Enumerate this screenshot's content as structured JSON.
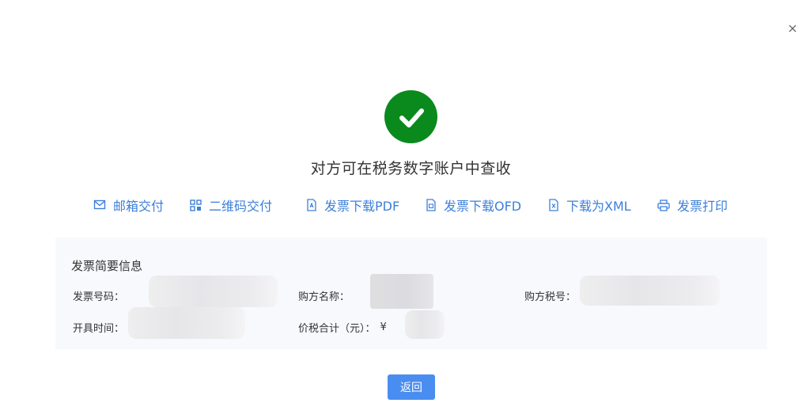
{
  "dialog": {
    "close_icon": "close-icon",
    "status_icon": "check-circle-icon",
    "status_color": "#0a8a1c",
    "message": "对方可在税务数字账户中查收"
  },
  "actions": [
    {
      "label": "邮箱交付",
      "icon": "mail-icon"
    },
    {
      "label": "二维码交付",
      "icon": "qrcode-icon"
    },
    {
      "label": "发票下载PDF",
      "icon": "pdf-file-icon"
    },
    {
      "label": "发票下载OFD",
      "icon": "ofd-file-icon"
    },
    {
      "label": "下载为XML",
      "icon": "xml-file-icon"
    },
    {
      "label": "发票打印",
      "icon": "printer-icon"
    }
  ],
  "accent_color": "#3d7fd9",
  "summary": {
    "title": "发票简要信息",
    "invoice_number_label": "发票号码：",
    "buyer_name_label": "购方名称：",
    "buyer_tax_id_label": "购方税号：",
    "issue_time_label": "开具时间：",
    "total_label": "价税合计（元）：",
    "total_prefix": "¥"
  },
  "footer": {
    "back_label": "返回",
    "back_color": "#4a8df0"
  }
}
